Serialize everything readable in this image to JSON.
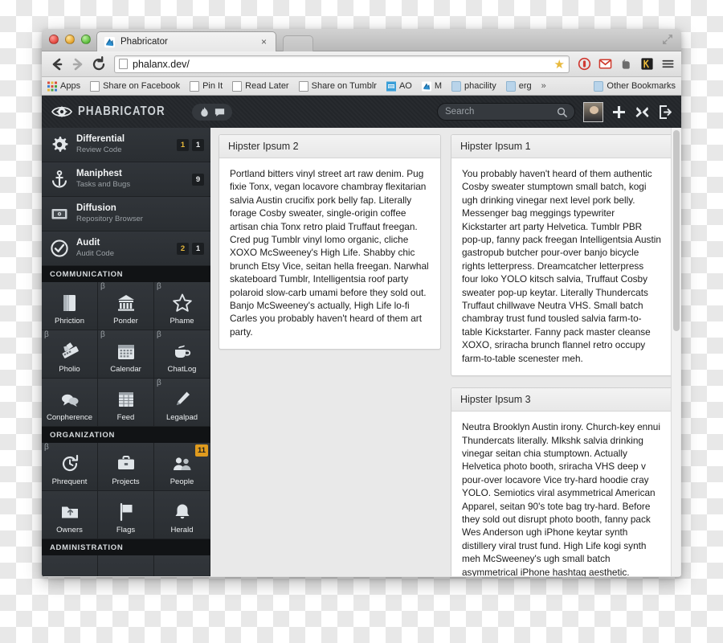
{
  "browser": {
    "tab": {
      "title": "Phabricator",
      "close_label": "×",
      "favicon": "phabricator-favicon"
    },
    "newtab_label": "",
    "nav": {
      "back": "←",
      "forward": "→",
      "reload": "⟳",
      "url": "phalanx.dev/",
      "star": "★"
    },
    "toolbar_icons": [
      "block-icon",
      "gmail-icon",
      "evernote-icon",
      "kippt-icon",
      "menu-icon"
    ],
    "bookmarks": [
      {
        "label": "Apps",
        "icon": "apps-grid-icon"
      },
      {
        "label": "Share on Facebook",
        "icon": "page-icon"
      },
      {
        "label": "Pin It",
        "icon": "page-icon"
      },
      {
        "label": "Read Later",
        "icon": "page-icon"
      },
      {
        "label": "Share on Tumblr",
        "icon": "page-icon"
      },
      {
        "label": "AO",
        "icon": "site-icon"
      },
      {
        "label": "M",
        "icon": "phabricator-favicon"
      },
      {
        "label": "phacility",
        "icon": "folder-icon"
      },
      {
        "label": "erg",
        "icon": "folder-icon"
      }
    ],
    "overflow_label": "»",
    "other_bookmarks": {
      "label": "Other Bookmarks",
      "icon": "folder-icon"
    }
  },
  "phabricator": {
    "wordmark": "PHABRICATOR",
    "header_pills": [
      "flame-icon",
      "chat-icon"
    ],
    "search": {
      "placeholder": "Search",
      "icon": "search-icon"
    },
    "header_actions": [
      "avatar",
      "plus-icon",
      "wrench-icon",
      "logout-icon"
    ],
    "nav_items": [
      {
        "title": "Differential",
        "subtitle": "Review Code",
        "icon": "gear-icon",
        "badges": [
          {
            "text": "1",
            "style": "gold"
          },
          {
            "text": "1",
            "style": "dark"
          }
        ]
      },
      {
        "title": "Maniphest",
        "subtitle": "Tasks and Bugs",
        "icon": "anchor-icon",
        "badges": [
          {
            "text": "9",
            "style": "dark"
          }
        ]
      },
      {
        "title": "Diffusion",
        "subtitle": "Repository Browser",
        "icon": "repository-icon",
        "badges": []
      },
      {
        "title": "Audit",
        "subtitle": "Audit Code",
        "icon": "check-circle-icon",
        "badges": [
          {
            "text": "2",
            "style": "gold"
          },
          {
            "text": "1",
            "style": "dark"
          }
        ]
      }
    ],
    "groups": [
      {
        "title": "COMMUNICATION",
        "apps": [
          {
            "label": "Phriction",
            "icon": "book-icon",
            "beta": false,
            "badge": null
          },
          {
            "label": "Ponder",
            "icon": "temple-icon",
            "beta": true,
            "badge": null
          },
          {
            "label": "Phame",
            "icon": "star-icon",
            "beta": true,
            "badge": null
          },
          {
            "label": "Pholio",
            "icon": "palette-icon",
            "beta": true,
            "badge": null
          },
          {
            "label": "Calendar",
            "icon": "calendar-icon",
            "beta": true,
            "badge": null
          },
          {
            "label": "ChatLog",
            "icon": "coffee-icon",
            "beta": true,
            "badge": null
          },
          {
            "label": "Conpherence",
            "icon": "speech-icon",
            "beta": false,
            "badge": null
          },
          {
            "label": "Feed",
            "icon": "table-icon",
            "beta": false,
            "badge": null
          },
          {
            "label": "Legalpad",
            "icon": "pen-icon",
            "beta": true,
            "badge": null
          }
        ]
      },
      {
        "title": "ORGANIZATION",
        "apps": [
          {
            "label": "Phrequent",
            "icon": "clock-arrow-icon",
            "beta": true,
            "badge": null
          },
          {
            "label": "Projects",
            "icon": "briefcase-icon",
            "beta": false,
            "badge": null
          },
          {
            "label": "People",
            "icon": "people-icon",
            "beta": false,
            "badge": "11"
          },
          {
            "label": "Owners",
            "icon": "folder-up-icon",
            "beta": false,
            "badge": null
          },
          {
            "label": "Flags",
            "icon": "flag-icon",
            "beta": false,
            "badge": null
          },
          {
            "label": "Herald",
            "icon": "bell-icon",
            "beta": false,
            "badge": null
          }
        ]
      },
      {
        "title": "ADMINISTRATION",
        "apps": [
          {
            "label": "",
            "icon": "console-icon",
            "beta": false,
            "badge": null
          },
          {
            "label": "",
            "icon": "mop-icon",
            "beta": false,
            "badge": null
          },
          {
            "label": "",
            "icon": "badge-icon",
            "beta": false,
            "badge": null
          }
        ]
      }
    ],
    "cards": {
      "left": [
        {
          "title": "Hipster Ipsum 2",
          "body": "Portland bitters vinyl street art raw denim. Pug fixie Tonx, vegan locavore chambray flexitarian salvia Austin crucifix pork belly fap. Literally forage Cosby sweater, single-origin coffee artisan chia Tonx retro plaid Truffaut freegan. Cred pug Tumblr vinyl lomo organic, cliche XOXO McSweeney's High Life. Shabby chic brunch Etsy Vice, seitan hella freegan. Narwhal skateboard Tumblr, Intelligentsia roof party polaroid slow-carb umami before they sold out. Banjo McSweeney's actually, High Life lo-fi Carles you probably haven't heard of them art party."
        }
      ],
      "right": [
        {
          "title": "Hipster Ipsum 1",
          "body": "You probably haven't heard of them authentic Cosby sweater stumptown small batch, kogi ugh drinking vinegar next level pork belly. Messenger bag meggings typewriter Kickstarter art party Helvetica. Tumblr PBR pop-up, fanny pack freegan Intelligentsia Austin gastropub butcher pour-over banjo bicycle rights letterpress. Dreamcatcher letterpress four loko YOLO kitsch salvia, Truffaut Cosby sweater pop-up keytar. Literally Thundercats Truffaut chillwave Neutra VHS. Small batch chambray trust fund tousled salvia farm-to-table Kickstarter. Fanny pack master cleanse XOXO, sriracha brunch flannel retro occupy farm-to-table scenester meh."
        },
        {
          "title": "Hipster Ipsum 3",
          "body": "Neutra Brooklyn Austin irony. Church-key ennui Thundercats literally. Mlkshk salvia drinking vinegar seitan chia stumptown. Actually Helvetica photo booth, sriracha VHS deep v pour-over locavore Vice try-hard hoodie cray YOLO. Semiotics viral asymmetrical American Apparel, seitan 90's tote bag try-hard. Before they sold out disrupt photo booth, fanny pack Wes Anderson ugh iPhone keytar synth distillery viral trust fund. High Life kogi synth meh McSweeney's ugh small batch asymmetrical iPhone hashtag aesthetic."
        }
      ]
    }
  },
  "colors": {
    "accent_gold": "#e8b93c",
    "badge_orange": "#e09b1e",
    "sidebar_bg": "#2b2f33",
    "header_bg": "#23262a",
    "content_bg": "#e9e9e9"
  }
}
